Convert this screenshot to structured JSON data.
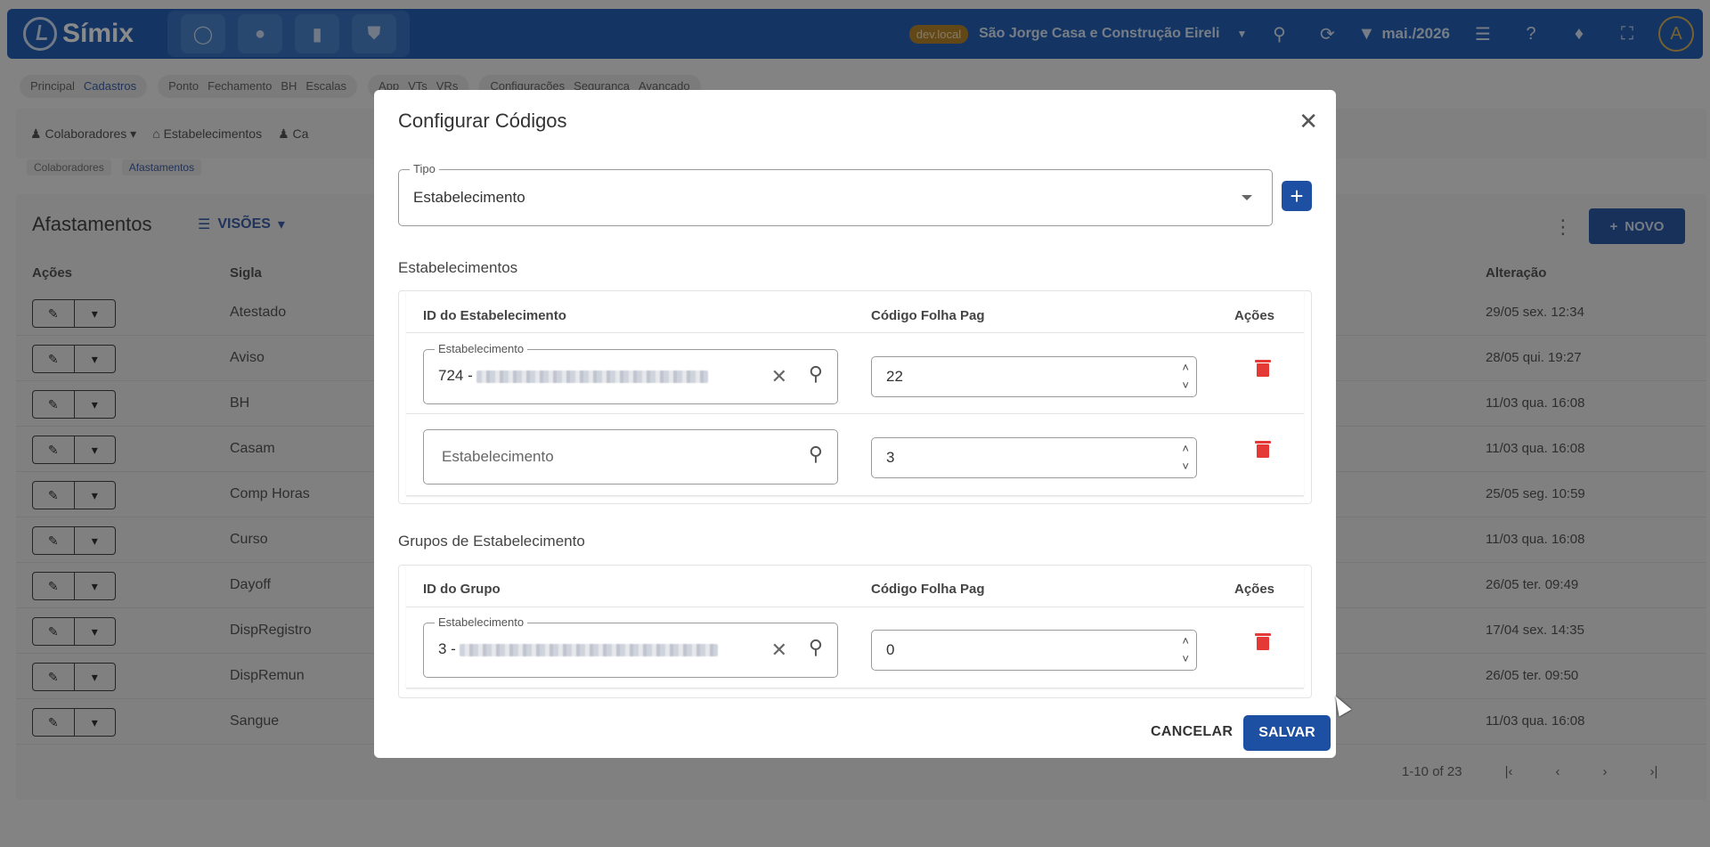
{
  "topbar": {
    "logo_text": "Símix",
    "env_badge": "dev.local",
    "company": "São Jorge Casa e Construção Eireli",
    "period": "mai./2026",
    "avatar_letter": "A"
  },
  "menu": {
    "group1": [
      "Principal",
      "Cadastros"
    ],
    "group2": [
      "Ponto",
      "Fechamento",
      "BH",
      "Escalas"
    ],
    "group3": [
      "App",
      "VTs",
      "VRs"
    ],
    "group4": [
      "Configurações",
      "Segurança",
      "Avançado"
    ]
  },
  "subnav": [
    "Colaboradores",
    "Estabelecimentos",
    "Ca"
  ],
  "breadcrumb": [
    "Colaboradores",
    "Afastamentos"
  ],
  "page": {
    "title": "Afastamentos",
    "views_label": "VISÕES",
    "new_label": "NOVO",
    "col_actions": "Ações",
    "col_sigla": "Sigla",
    "col_alteracao": "Alteração",
    "rows": [
      {
        "sigla": "Atestado",
        "alteracao": "29/05 sex. 12:34"
      },
      {
        "sigla": "Aviso",
        "alteracao": "28/05 qui. 19:27"
      },
      {
        "sigla": "BH",
        "alteracao": "11/03 qua. 16:08"
      },
      {
        "sigla": "Casam",
        "alteracao": "11/03 qua. 16:08"
      },
      {
        "sigla": "Comp Horas",
        "alteracao": "25/05 seg. 10:59"
      },
      {
        "sigla": "Curso",
        "alteracao": "11/03 qua. 16:08"
      },
      {
        "sigla": "Dayoff",
        "alteracao": "26/05 ter. 09:49"
      },
      {
        "sigla": "DispRegistro",
        "alteracao": "17/04 sex. 14:35"
      },
      {
        "sigla": "DispRemun",
        "alteracao": "26/05 ter. 09:50"
      },
      {
        "sigla": "Sangue",
        "alteracao": "11/03 qua. 16:08"
      }
    ],
    "pagination": "1-10 of 23"
  },
  "modal": {
    "title": "Configurar Códigos",
    "tipo_label": "Tipo",
    "tipo_value": "Estabelecimento",
    "section1_title": "Estabelecimentos",
    "section1_col1": "ID do Estabelecimento",
    "section1_col2": "Código Folha Pag",
    "section1_col3": "Ações",
    "row1_label": "Estabelecimento",
    "row1_value_prefix": "724 -",
    "row1_code": "22",
    "row2_placeholder": "Estabelecimento",
    "row2_code": "3",
    "section2_title": "Grupos de Estabelecimento",
    "section2_col1": "ID do Grupo",
    "section2_col2": "Código Folha Pag",
    "section2_col3": "Ações",
    "grow1_label": "Estabelecimento",
    "grow1_value_prefix": "3 -",
    "grow1_code": "0",
    "cancel_label": "CANCELAR",
    "save_label": "SALVAR"
  },
  "colors": {
    "topbar": "#2563b8",
    "primary_button": "#1d4fa3",
    "delete": "#e53935",
    "env_badge": "#b8862c"
  }
}
